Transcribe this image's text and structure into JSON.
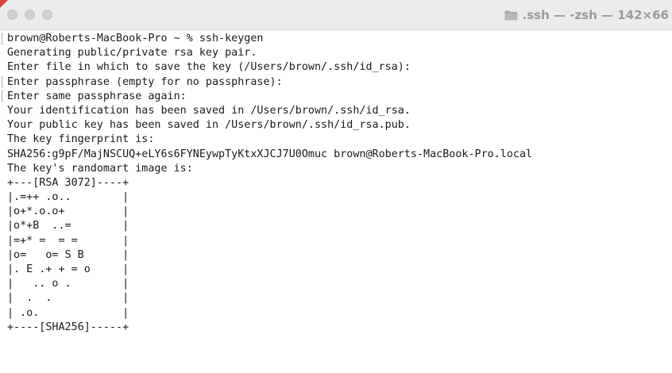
{
  "window": {
    "title": ".ssh — -zsh — 142×66"
  },
  "terminal": {
    "prompt": "brown@Roberts-MacBook-Pro ~ % ",
    "command": "ssh-keygen",
    "lines": [
      "Generating public/private rsa key pair.",
      "Enter file in which to save the key (/Users/brown/.ssh/id_rsa):",
      "Enter passphrase (empty for no passphrase):",
      "Enter same passphrase again:",
      "Your identification has been saved in /Users/brown/.ssh/id_rsa.",
      "Your public key has been saved in /Users/brown/.ssh/id_rsa.pub.",
      "The key fingerprint is:",
      "SHA256:g9pF/MajNSCUQ+eLY6s6FYNEywpTyKtxXJCJ7U0Omuc brown@Roberts-MacBook-Pro.local",
      "The key's randomart image is:"
    ],
    "randomart": [
      "+---[RSA 3072]----+",
      "|.=++ .o..        |",
      "|o+*.o.o+         |",
      "|o*+B  ..=        |",
      "|=+* =  = =       |",
      "|o=   o= S B      |",
      "|. E .+ + = o     |",
      "|   .. o .        |",
      "|  .  .           |",
      "| .o.             |",
      "+----[SHA256]-----+"
    ]
  }
}
